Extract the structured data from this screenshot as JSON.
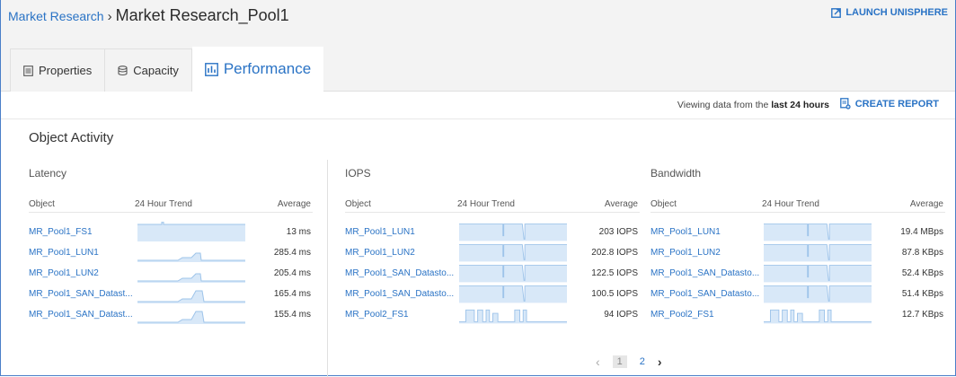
{
  "breadcrumb": {
    "parent": "Market Research",
    "separator": "›",
    "title": "Market Research_Pool1"
  },
  "launch_label": "LAUNCH UNISPHERE",
  "tabs": [
    {
      "label": "Properties",
      "icon": "list-icon"
    },
    {
      "label": "Capacity",
      "icon": "database-icon"
    },
    {
      "label": "Performance",
      "icon": "bar-chart-icon"
    }
  ],
  "viewing": {
    "prefix": "Viewing data from the",
    "range": "last 24 hours"
  },
  "create_report": "CREATE REPORT",
  "object_activity": "Object Activity",
  "columns": {
    "object": "Object",
    "trend": "24 Hour Trend",
    "average": "Average"
  },
  "latency": {
    "title": "Latency",
    "rows": [
      {
        "name": "MR_Pool1_FS1",
        "avg": "13 ms",
        "trend": "flat-notch"
      },
      {
        "name": "MR_Pool1_LUN1",
        "avg": "285.4 ms",
        "trend": "low-bump"
      },
      {
        "name": "MR_Pool1_LUN2",
        "avg": "205.4 ms",
        "trend": "low-bump"
      },
      {
        "name": "MR_Pool1_SAN_Datast...",
        "avg": "165.4 ms",
        "trend": "low-bump-tall"
      },
      {
        "name": "MR_Pool1_SAN_Datast...",
        "avg": "155.4 ms",
        "trend": "low-bump-tall"
      }
    ]
  },
  "iops": {
    "title": "IOPS",
    "rows": [
      {
        "name": "MR_Pool1_LUN1",
        "avg": "203 IOPS",
        "trend": "high-notch"
      },
      {
        "name": "MR_Pool1_LUN2",
        "avg": "202.8 IOPS",
        "trend": "high-notch"
      },
      {
        "name": "MR_Pool1_SAN_Datasto...",
        "avg": "122.5 IOPS",
        "trend": "high-notch"
      },
      {
        "name": "MR_Pool1_SAN_Datasto...",
        "avg": "100.5 IOPS",
        "trend": "high-notch"
      },
      {
        "name": "MR_Pool2_FS1",
        "avg": "94 IOPS",
        "trend": "pulses"
      }
    ]
  },
  "bandwidth": {
    "title": "Bandwidth",
    "rows": [
      {
        "name": "MR_Pool1_LUN1",
        "avg": "19.4 MBps",
        "trend": "high-notch"
      },
      {
        "name": "MR_Pool1_LUN2",
        "avg": "87.8 KBps",
        "trend": "high-notch"
      },
      {
        "name": "MR_Pool1_SAN_Datasto...",
        "avg": "52.4 KBps",
        "trend": "high-notch"
      },
      {
        "name": "MR_Pool1_SAN_Datasto...",
        "avg": "51.4 KBps",
        "trend": "high-notch"
      },
      {
        "name": "MR_Pool2_FS1",
        "avg": "12.7 KBps",
        "trend": "pulses"
      }
    ]
  },
  "pagination": {
    "prev": "‹",
    "pages": [
      "1",
      "2"
    ],
    "next": "›"
  },
  "colors": {
    "accent": "#2a73c5",
    "spark_fill": "#d8e8f8",
    "spark_line": "#9ec4ea"
  }
}
